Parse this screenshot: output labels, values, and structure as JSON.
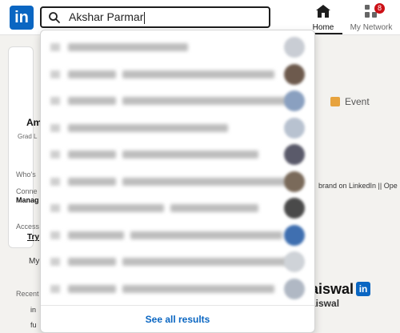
{
  "app": {
    "logo_text": "in"
  },
  "search": {
    "value": "Akshar Parmar"
  },
  "nav": {
    "home_label": "Home",
    "network_label": "My Network",
    "network_badge": "8"
  },
  "background": {
    "profile_initials": "Am",
    "profile_sub": "Grad L",
    "whos_label": "Who's",
    "connect_label": "Conne",
    "manage_label": "Manag",
    "access_label": "Access",
    "try_label": "Try",
    "my_label": "My",
    "recent_label": "Recent",
    "hashtag1": "in",
    "hashtag2": "fu",
    "event_label": "Event",
    "brand_line": "brand on LinkedIn || Ope",
    "person_name": "aiswal",
    "person_sub": "aiswal",
    "in_badge": "in"
  },
  "dropdown": {
    "see_all_label": "See all results",
    "results": [
      {
        "avatar_color": "#c9cdd4"
      },
      {
        "avatar_color": "#6d5a4d"
      },
      {
        "avatar_color": "#8aa0c0"
      },
      {
        "avatar_color": "#b8c2d0"
      },
      {
        "avatar_color": "#5a5a6a"
      },
      {
        "avatar_color": "#7a6a5a"
      },
      {
        "avatar_color": "#4a4a4a"
      },
      {
        "avatar_color": "#3f6fb0"
      },
      {
        "avatar_color": "#cfd3d8"
      },
      {
        "avatar_color": "#b0b8c4"
      }
    ]
  },
  "colors": {
    "brand": "#0a66c2",
    "badge": "#cc1016"
  }
}
